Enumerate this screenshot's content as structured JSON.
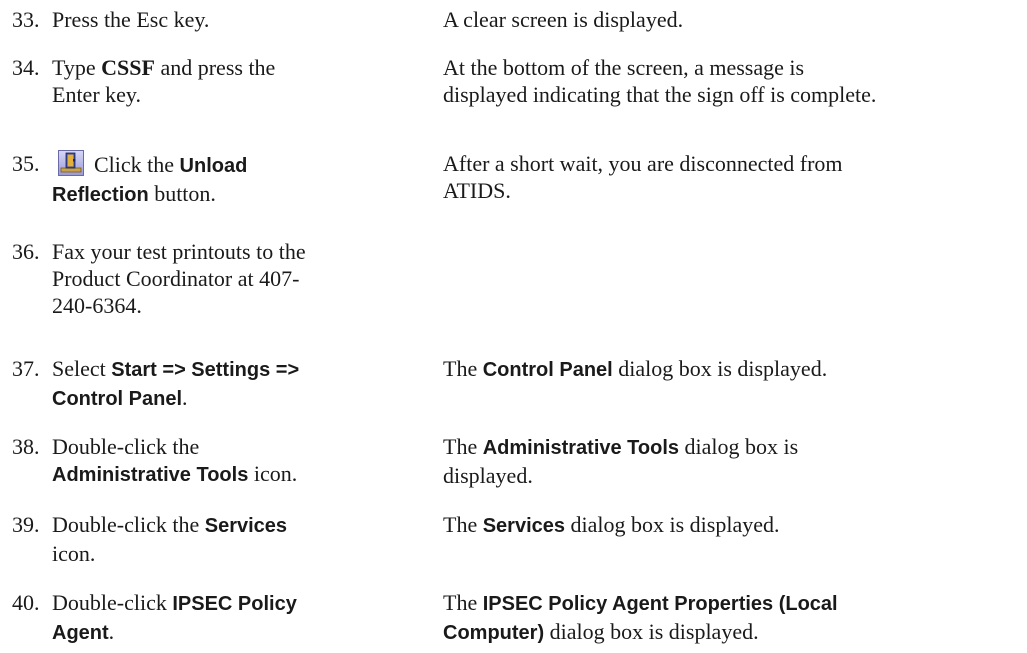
{
  "steps": [
    {
      "num": "33.",
      "action": {
        "t1": "Press the Esc key."
      },
      "result": {
        "t1": "A clear screen is displayed."
      }
    },
    {
      "num": "34.",
      "action": {
        "t1": "Type ",
        "b1": "CSSF",
        "t2": " and press the",
        "t3": "Enter key."
      },
      "result": {
        "t1": "At the bottom of the screen, a message is",
        "t2": "displayed indicating that the sign off is complete."
      }
    },
    {
      "num": "35.",
      "icon": "unload-reflection-icon",
      "action": {
        "t1": "Click the ",
        "b1": "Unload",
        "b2": "Reflection",
        "t2": " button."
      },
      "result": {
        "t1": "After a short wait, you are disconnected from",
        "t2": "ATIDS."
      }
    },
    {
      "num": "36.",
      "action": {
        "t1": "Fax your test printouts to the",
        "t2": "Product Coordinator at 407-",
        "t3": "240-6364."
      }
    },
    {
      "num": "37.",
      "action": {
        "t1": "Select ",
        "b1": "Start => Settings =>",
        "b2": "Control Panel",
        "t2": "."
      },
      "result": {
        "t1": "The ",
        "b1": "Control Panel",
        "t2": " dialog box is displayed."
      }
    },
    {
      "num": "38.",
      "action": {
        "t1": "Double-click the",
        "b1": "Administrative Tools",
        "t2": " icon."
      },
      "result": {
        "t1": "The ",
        "b1": "Administrative Tools",
        "t2": " dialog box is",
        "t3": "displayed."
      }
    },
    {
      "num": "39.",
      "action": {
        "t1": "Double-click the ",
        "b1": "Services",
        "t2": "icon."
      },
      "result": {
        "t1": "The ",
        "b1": "Services",
        "t2": " dialog box is displayed."
      }
    },
    {
      "num": "40.",
      "action": {
        "t1": "Double-click ",
        "b1": "IPSEC Policy",
        "b2": "Agent",
        "t2": "."
      },
      "result": {
        "t1": "The ",
        "b1": "IPSEC Policy Agent Properties (Local",
        "b2": "Computer)",
        "t2": " dialog box is displayed."
      }
    }
  ]
}
